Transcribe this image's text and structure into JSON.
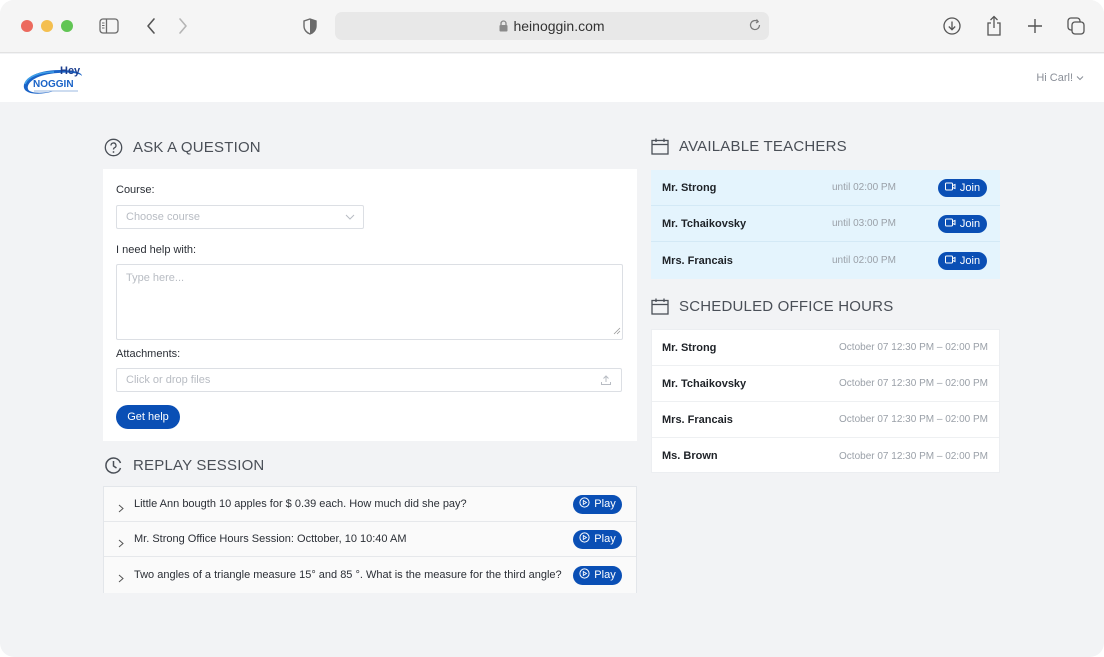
{
  "browser": {
    "url": "heinoggin.com",
    "icons": [
      "sidebar-icon",
      "back-icon",
      "forward-icon",
      "shield-icon",
      "lock-icon",
      "reload-icon",
      "download-icon",
      "share-icon",
      "new-tab-icon",
      "tabs-overview-icon"
    ]
  },
  "header": {
    "logo_top": "Hey",
    "logo_bottom": "NOGGIN",
    "user_greeting": "Hi Carl!"
  },
  "ask": {
    "title": "ASK A QUESTION",
    "course_label": "Course:",
    "course_placeholder": "Choose course",
    "help_label": "I need help with:",
    "help_placeholder": "Type here...",
    "attachments_label": "Attachments:",
    "attachments_placeholder": "Click or drop files",
    "submit_label": "Get help"
  },
  "replay": {
    "title": "REPLAY SESSION",
    "play_label": "Play",
    "items": [
      {
        "text": "Little Ann bougth 10 apples for $ 0.39 each. How much did she pay?"
      },
      {
        "text": "Mr. Strong Office Hours Session: Octtober, 10 10:40 AM"
      },
      {
        "text": "Two angles of a triangle measure 15° and 85 °. What is the measure for the third angle?"
      }
    ]
  },
  "available": {
    "title": "AVAILABLE TEACHERS",
    "join_label": "Join",
    "teachers": [
      {
        "name": "Mr. Strong",
        "until": "until 02:00 PM"
      },
      {
        "name": "Mr. Tchaikovsky",
        "until": "until 03:00 PM"
      },
      {
        "name": "Mrs. Francais",
        "until": "until 02:00 PM"
      }
    ]
  },
  "office_hours": {
    "title": "SCHEDULED OFFICE HOURS",
    "entries": [
      {
        "name": "Mr. Strong",
        "time": "October 07 12:30 PM – 02:00 PM"
      },
      {
        "name": "Mr. Tchaikovsky",
        "time": "October 07 12:30 PM – 02:00 PM"
      },
      {
        "name": "Mrs. Francais",
        "time": "October 07 12:30 PM – 02:00 PM"
      },
      {
        "name": "Ms. Brown",
        "time": "October 07 12:30 PM – 02:00 PM"
      }
    ]
  },
  "colors": {
    "primary": "#0a4fb5",
    "page_bg": "#f2f3f5",
    "teachers_bg": "#e4f4fd"
  }
}
